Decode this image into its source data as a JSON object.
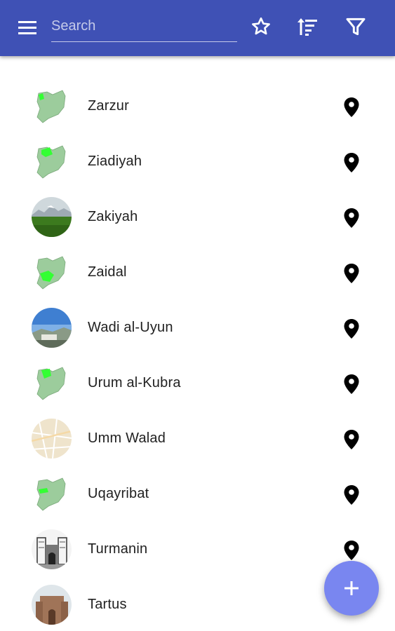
{
  "toolbar": {
    "menu_icon": "menu-icon",
    "search_placeholder": "Search",
    "search_value": "",
    "favorite_icon": "star-outline-icon",
    "sort_icon": "sort-icon",
    "filter_icon": "filter-icon"
  },
  "colors": {
    "app_bar": "#3f51b5",
    "fab": "#7986f0",
    "map_fill": "#9ccc9c",
    "map_highlight": "#33ff33"
  },
  "places": [
    {
      "name": "Zarzur",
      "thumbnail": "syria-map-highlight-northwest",
      "action_icon": "location-pin-icon"
    },
    {
      "name": "Ziadiyah",
      "thumbnail": "syria-map-highlight-north",
      "action_icon": "location-pin-icon"
    },
    {
      "name": "Zakiyah",
      "thumbnail": "photo-green-field-mountains",
      "action_icon": "location-pin-icon"
    },
    {
      "name": "Zaidal",
      "thumbnail": "syria-map-highlight-west",
      "action_icon": "location-pin-icon"
    },
    {
      "name": "Wadi al-Uyun",
      "thumbnail": "photo-valley-sky",
      "action_icon": "location-pin-icon"
    },
    {
      "name": "Urum al-Kubra",
      "thumbnail": "syria-map-highlight-north",
      "action_icon": "location-pin-icon"
    },
    {
      "name": "Umm Walad",
      "thumbnail": "street-map",
      "action_icon": "location-pin-icon"
    },
    {
      "name": "Uqayribat",
      "thumbnail": "syria-map-highlight-central",
      "action_icon": "location-pin-icon"
    },
    {
      "name": "Turmanin",
      "thumbnail": "sketch-church-ruins",
      "action_icon": "location-pin-icon"
    },
    {
      "name": "Tartus",
      "thumbnail": "photo-stone-cathedral",
      "action_icon": "location-pin-icon"
    }
  ],
  "fab": {
    "icon": "plus-icon"
  }
}
